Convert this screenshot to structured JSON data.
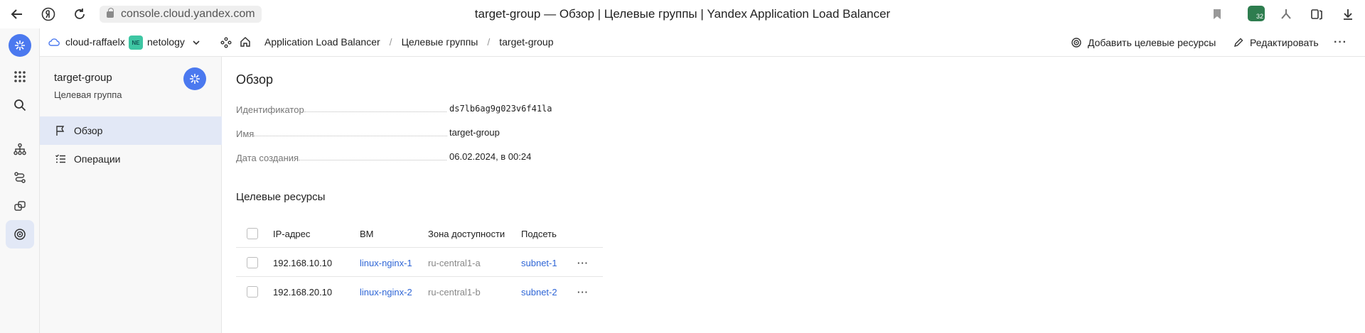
{
  "browser": {
    "url": "console.cloud.yandex.com",
    "page_title": "target-group — Обзор | Целевые группы | Yandex Application Load Balancer",
    "downloads_badge": "32"
  },
  "topnav": {
    "cloud": "cloud-raffaelx",
    "folder_badge": "NE",
    "folder": "netology",
    "breadcrumbs": [
      "Application Load Balancer",
      "Целевые группы",
      "target-group"
    ],
    "add_targets_label": "Добавить целевые ресурсы",
    "edit_label": "Редактировать"
  },
  "sidebar": {
    "title": "target-group",
    "subtitle": "Целевая группа",
    "items": [
      {
        "label": "Обзор",
        "icon": "flag-icon",
        "active": true
      },
      {
        "label": "Операции",
        "icon": "list-icon",
        "active": false
      }
    ]
  },
  "overview": {
    "heading": "Обзор",
    "fields": [
      {
        "key": "Идентификатор",
        "value": "ds7lb6ag9g023v6f41la"
      },
      {
        "key": "Имя",
        "value": "target-group"
      },
      {
        "key": "Дата создания",
        "value": "06.02.2024, в 00:24"
      }
    ]
  },
  "targets": {
    "heading": "Целевые ресурсы",
    "columns": [
      "IP-адрес",
      "ВМ",
      "Зона доступности",
      "Подсеть"
    ],
    "rows": [
      {
        "ip": "192.168.10.10",
        "vm": "linux-nginx-1",
        "zone": "ru-central1-a",
        "subnet": "subnet-1"
      },
      {
        "ip": "192.168.20.10",
        "vm": "linux-nginx-2",
        "zone": "ru-central1-b",
        "subnet": "subnet-2"
      }
    ]
  },
  "colors": {
    "accent": "#4b79ef",
    "link": "#2f66d6",
    "active_bg": "#e2e8f6"
  }
}
